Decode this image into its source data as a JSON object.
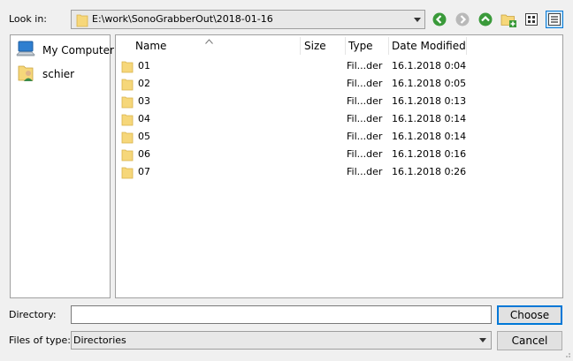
{
  "look_in": {
    "label": "Look in:",
    "path": "E:\\work\\SonoGrabberOut\\2018-01-16"
  },
  "toolbar": {
    "back_icon": "back-arrow-icon",
    "forward_icon": "forward-arrow-icon",
    "up_icon": "up-arrow-icon",
    "new_folder_icon": "new-folder-icon",
    "list_view_icon": "list-view-icon",
    "detail_view_icon": "detail-view-icon",
    "accent_green": "#3a9a3a"
  },
  "sidebar": {
    "items": [
      {
        "label": "My Computer",
        "icon": "computer-icon"
      },
      {
        "label": "schier",
        "icon": "user-folder-icon"
      }
    ]
  },
  "file_list": {
    "columns": {
      "name": "Name",
      "size": "Size",
      "type": "Type",
      "date": "Date Modified"
    },
    "rows": [
      {
        "name": "01",
        "size": "",
        "type": "Fil...der",
        "date": "16.1.2018 0:04"
      },
      {
        "name": "02",
        "size": "",
        "type": "Fil...der",
        "date": "16.1.2018 0:05"
      },
      {
        "name": "03",
        "size": "",
        "type": "Fil...der",
        "date": "16.1.2018 0:13"
      },
      {
        "name": "04",
        "size": "",
        "type": "Fil...der",
        "date": "16.1.2018 0:14"
      },
      {
        "name": "05",
        "size": "",
        "type": "Fil...der",
        "date": "16.1.2018 0:14"
      },
      {
        "name": "06",
        "size": "",
        "type": "Fil...der",
        "date": "16.1.2018 0:16"
      },
      {
        "name": "07",
        "size": "",
        "type": "Fil...der",
        "date": "16.1.2018 0:26"
      }
    ]
  },
  "directory": {
    "label": "Directory:",
    "value": ""
  },
  "files_of_type": {
    "label": "Files of type:",
    "value": "Directories"
  },
  "buttons": {
    "choose": "Choose",
    "cancel": "Cancel"
  },
  "colors": {
    "folder": "#f6d77a",
    "selection_border": "#0078d7"
  }
}
